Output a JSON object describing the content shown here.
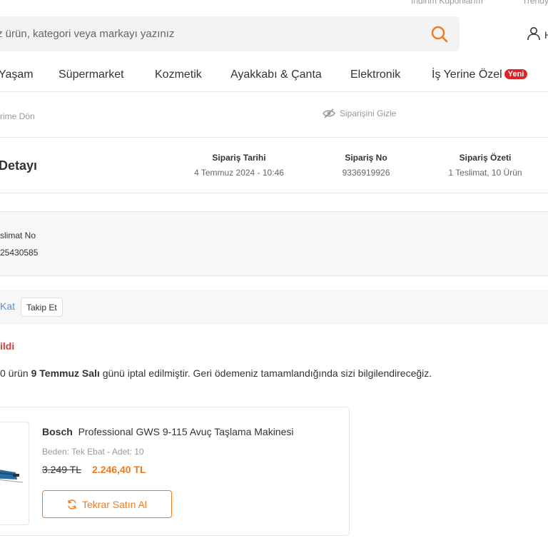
{
  "topbar": {
    "coupons": "İndirim Kuponlarım",
    "trendyol": "Trendy"
  },
  "search": {
    "placeholder": "z ürün, kategori veya markayı yazınız"
  },
  "user": {
    "truncated": "H"
  },
  "nav": {
    "items": [
      {
        "label": "Yaşam"
      },
      {
        "label": "Süpermarket"
      },
      {
        "label": "Kozmetik"
      },
      {
        "label": "Ayakkabı & Çanta"
      },
      {
        "label": "Elektronik"
      },
      {
        "label": "İş Yerine Özel",
        "badge": "Yeni"
      }
    ]
  },
  "order": {
    "back_label": "rime Dön",
    "hide_label": "Siparişini Gizle",
    "title": "Detayı",
    "date_label": "Sipariş Tarihi",
    "date_value": "4 Temmuz 2024 - 10:46",
    "no_label": "Sipariş No",
    "no_value": "9336919926",
    "summary_label": "Sipariş Özeti",
    "summary_value": "1 Teslimat, 10 Ürün"
  },
  "delivery": {
    "label": "slimat No",
    "value": "25430585"
  },
  "cargo": {
    "link": "Kat",
    "track_button": "Takip Et"
  },
  "status": {
    "title": "ildi",
    "text_prefix": "0 ürün ",
    "text_date": "9 Temmuz Salı",
    "text_suffix": " günü iptal edilmiştir. Geri ödemeniz tamamlandığında sizi bilgilendireceğiz."
  },
  "product": {
    "brand": "Bosch",
    "name": "Professional GWS 9-115 Avuç Taşlama Makinesi",
    "variant": "Beden: Tek Ebat - Adet: 10",
    "old_price": "3.249 TL",
    "new_price": "2.246,40 TL",
    "rebuy_button": "Tekrar Satın Al"
  },
  "colors": {
    "accent": "#f27a1a",
    "badge": "#d7272a",
    "status": "#d23f3f",
    "link": "#5a8fd6"
  },
  "icons": [
    "search-icon",
    "user-icon",
    "eye-slash-icon",
    "refresh-icon"
  ]
}
